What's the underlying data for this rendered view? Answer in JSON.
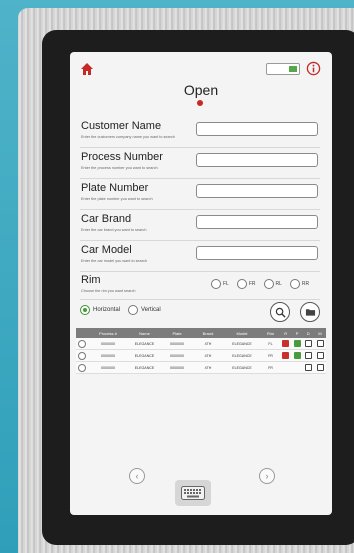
{
  "page": {
    "title": "Open"
  },
  "fields": [
    {
      "label": "Customer Name",
      "hint": "Enter the customers company name you want to search"
    },
    {
      "label": "Process Number",
      "hint": "Enter the process number you want to search"
    },
    {
      "label": "Plate Number",
      "hint": "Enter the plate number you want to search"
    },
    {
      "label": "Car Brand",
      "hint": "Enter the car brand you want to search"
    },
    {
      "label": "Car Model",
      "hint": "Enter the car model you want to search"
    }
  ],
  "rim": {
    "label": "Rim",
    "hint": "Choose the rim you want search",
    "options": [
      "FL",
      "FR",
      "RL",
      "RR"
    ]
  },
  "orientation": {
    "options": [
      "Horizontal",
      "Vertical"
    ],
    "selected": "Horizontal"
  },
  "table": {
    "headers": [
      "Process #",
      "Name",
      "Plate",
      "Brand",
      "Model",
      "Rim",
      "R",
      "P",
      "D",
      "M"
    ],
    "rows": [
      [
        "0000000",
        "ELEGANCE",
        "0000000",
        "4TH",
        "ELEGANCE",
        "FL"
      ],
      [
        "0000000",
        "ELEGANCE",
        "0000000",
        "4TH",
        "ELEGANCE",
        "FR"
      ],
      [
        "0000000",
        "ELEGANCE",
        "0000000",
        "4TH",
        "ELEGANCE",
        "FR"
      ]
    ]
  },
  "icons": {
    "home": "home-icon",
    "info": "info-icon",
    "search": "search-icon",
    "folder": "folder-icon",
    "keyboard": "keyboard-icon",
    "prev": "chevron-left-icon",
    "next": "chevron-right-icon"
  },
  "colors": {
    "accent_red": "#c62828",
    "accent_green": "#3f9e36",
    "table_header": "#7c7c7c"
  }
}
